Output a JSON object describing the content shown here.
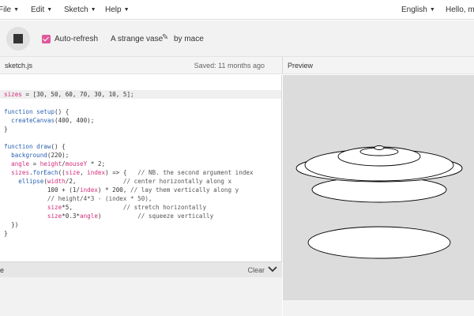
{
  "nav": {
    "file": "File",
    "edit": "Edit",
    "sketch": "Sketch",
    "help": "Help",
    "language": "English",
    "user": "Hello, ma"
  },
  "toolbar": {
    "autorefresh_label": "Auto-refresh",
    "autorefresh_checked": true,
    "sketch_name": "A strange vase",
    "author": "by mace"
  },
  "editor": {
    "filename": "sketch.js",
    "saved": "Saved: 11 months ago"
  },
  "preview": {
    "label": "Preview"
  },
  "console": {
    "label": "e",
    "clear": "Clear"
  },
  "code_lines": [
    "sizes = [30, 50, 60, 70, 30, 10, 5];",
    "",
    "function setup() {",
    "  createCanvas(400, 400);",
    "}",
    "",
    "function draw() {",
    "  background(220);",
    "  angle = height/mouseY * 2;",
    "  sizes.forEach((size, index) => {   // NB. the second argument index",
    "    ellipse(width/2,             // center horizontally along x",
    "            100 + (1/index) * 200, // lay them vertically along y",
    "            // height/4*3 - (index * 50),",
    "            size*5,              // stretch horizontally",
    "            size*0.3*angle)          // squeeze vertically",
    "  })",
    "}"
  ],
  "colors": {
    "accent": "#e0599b",
    "keyword": "#2b61b3",
    "variable": "#d32e7b",
    "preview_bg": "#dcdcdc"
  }
}
